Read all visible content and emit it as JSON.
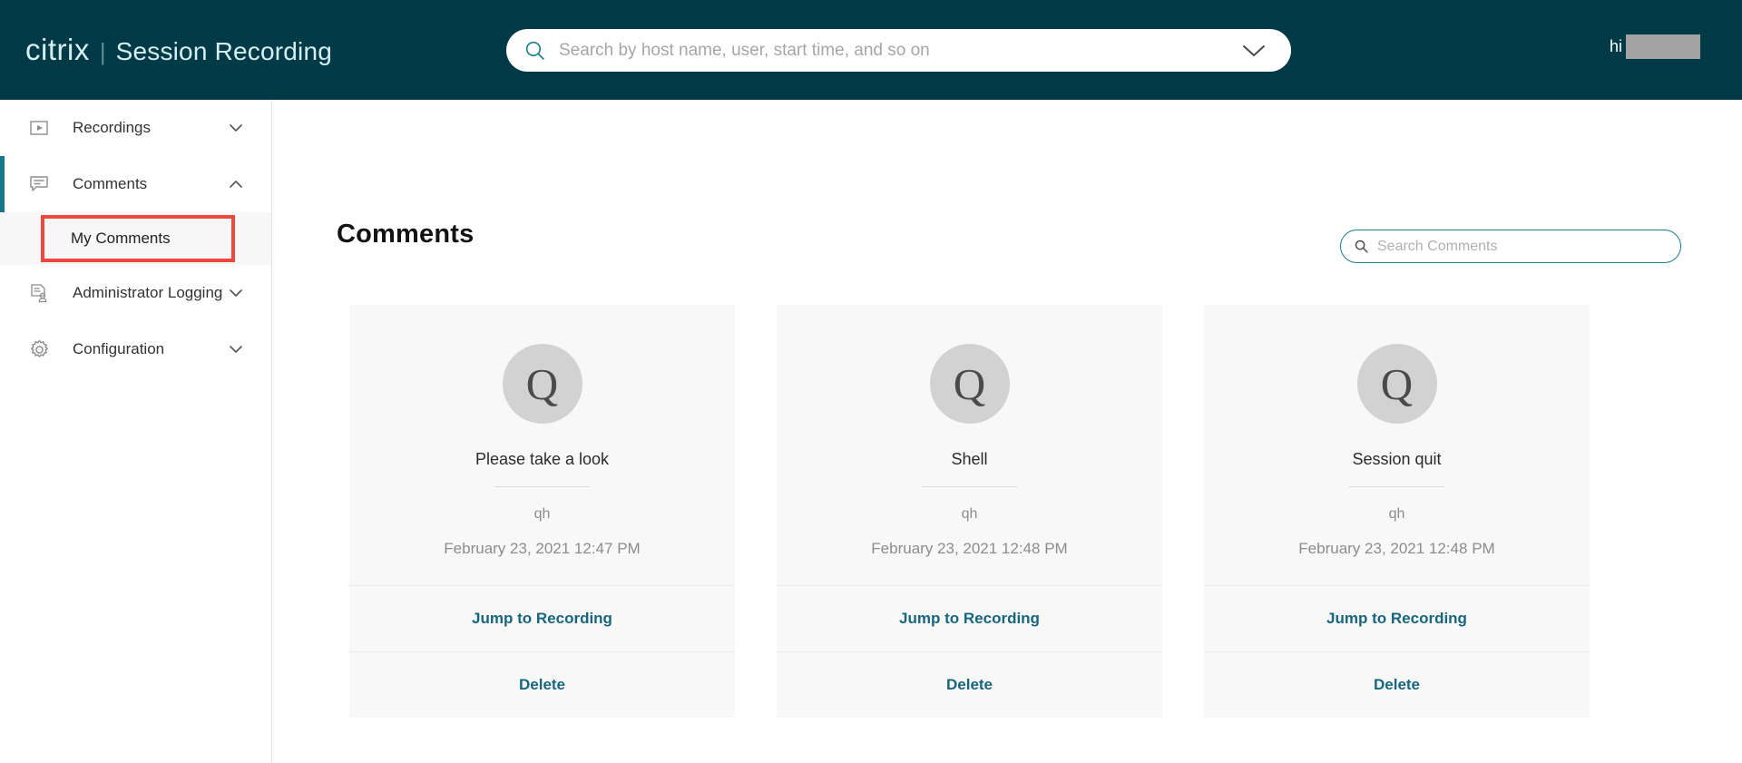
{
  "header": {
    "brand_name": "citrix",
    "brand_separator": "|",
    "product_name": "Session Recording",
    "search": {
      "placeholder": "Search by host name, user, start time, and so on",
      "value": "",
      "icon": "search-icon",
      "expand_icon": "chevron-down-icon"
    },
    "user": {
      "greeting": "hi",
      "name_redacted": ""
    },
    "background_color": "#003a47"
  },
  "sidebar": {
    "items": [
      {
        "label": "Recordings",
        "icon": "play-video-icon",
        "chevron": "chevron-down-icon",
        "expanded": false,
        "active": false
      },
      {
        "label": "Comments",
        "icon": "comment-bubble-icon",
        "chevron": "chevron-up-icon",
        "expanded": true,
        "active": true
      },
      {
        "label": "Administrator Logging",
        "icon": "admin-log-icon",
        "chevron": "chevron-down-icon",
        "expanded": false,
        "active": false
      },
      {
        "label": "Configuration",
        "icon": "gear-icon",
        "chevron": "chevron-down-icon",
        "expanded": false,
        "active": false
      }
    ],
    "sub_items": [
      {
        "label": "My Comments",
        "parent": "Comments",
        "selected": true,
        "annotated": true
      }
    ],
    "accent_color": "#17788c",
    "annotation_color": "#f0473e"
  },
  "main": {
    "page_title": "Comments",
    "search": {
      "placeholder": "Search Comments",
      "value": "",
      "icon": "search-icon",
      "border_color": "#1d7d8e"
    },
    "link_color": "#17667d",
    "cards": [
      {
        "avatar_letter": "Q",
        "title": "Please take a look",
        "author": "qh",
        "date": "February 23, 2021 12:47 PM",
        "actions": [
          {
            "label": "Jump to Recording",
            "name": "jump-to-recording-button"
          },
          {
            "label": "Delete",
            "name": "delete-button"
          }
        ]
      },
      {
        "avatar_letter": "Q",
        "title": "Shell",
        "author": "qh",
        "date": "February 23, 2021 12:48 PM",
        "actions": [
          {
            "label": "Jump to Recording",
            "name": "jump-to-recording-button"
          },
          {
            "label": "Delete",
            "name": "delete-button"
          }
        ]
      },
      {
        "avatar_letter": "Q",
        "title": "Session quit",
        "author": "qh",
        "date": "February 23, 2021 12:48 PM",
        "actions": [
          {
            "label": "Jump to Recording",
            "name": "jump-to-recording-button"
          },
          {
            "label": "Delete",
            "name": "delete-button"
          }
        ]
      }
    ]
  }
}
